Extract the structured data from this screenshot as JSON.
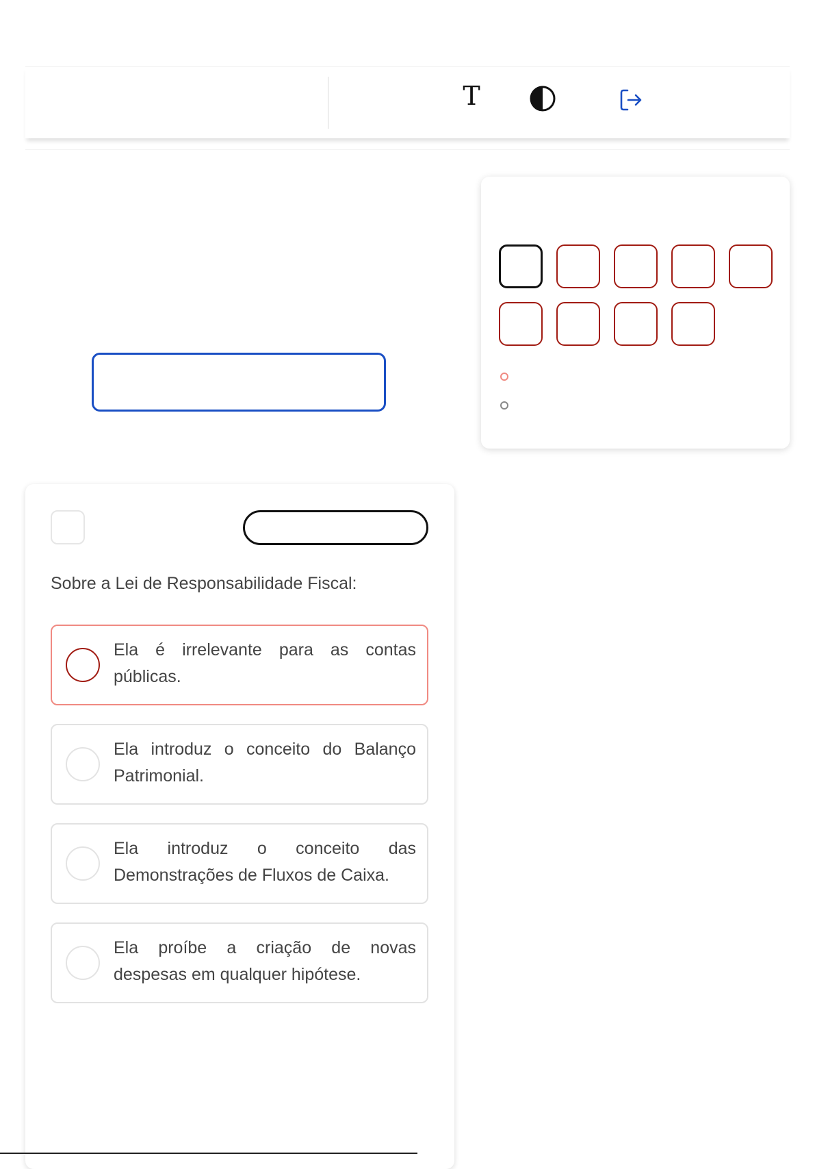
{
  "toolbar": {
    "icons": [
      "text-size-icon",
      "contrast-icon",
      "logout-icon"
    ],
    "text_icon_glyph": "T",
    "accent_color": "#1a4fc4"
  },
  "navigator": {
    "question_count": 9,
    "current_index": 1,
    "colors": {
      "unanswered": "#a11b12",
      "current": "#111111"
    },
    "legend": [
      {
        "color": "#f08a82"
      },
      {
        "color": "#888888"
      }
    ]
  },
  "question": {
    "prompt": "Sobre a Lei de Responsabilidade Fiscal:",
    "selected_index": 0,
    "options": [
      {
        "text": "Ela é irrelevante para as contas públicas."
      },
      {
        "text": "Ela introduz o conceito do Balanço Patrimonial."
      },
      {
        "text": "Ela introduz o conceito das Demonstrações de Fluxos de Caixa."
      },
      {
        "text": "Ela proíbe a criação de novas despesas em qualquer hipótese."
      }
    ]
  }
}
